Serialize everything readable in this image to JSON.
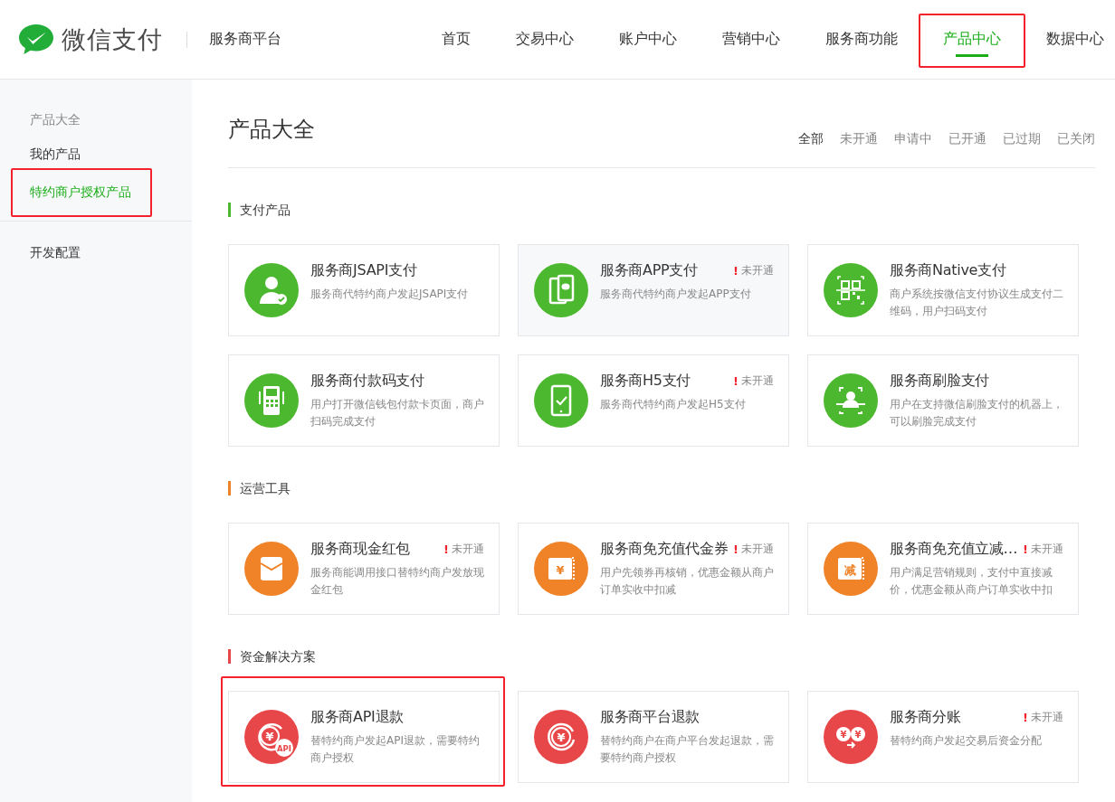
{
  "header": {
    "brand": "微信支付",
    "platform": "服务商平台",
    "nav": [
      {
        "label": "首页",
        "selected": false,
        "highlighted": false
      },
      {
        "label": "交易中心",
        "selected": false,
        "highlighted": false
      },
      {
        "label": "账户中心",
        "selected": false,
        "highlighted": false
      },
      {
        "label": "营销中心",
        "selected": false,
        "highlighted": false
      },
      {
        "label": "服务商功能",
        "selected": false,
        "highlighted": false
      },
      {
        "label": "产品中心",
        "selected": true,
        "highlighted": true
      },
      {
        "label": "数据中心",
        "selected": false,
        "highlighted": false
      }
    ]
  },
  "sidebar": {
    "groups": [
      {
        "heading": "产品大全",
        "items": [
          {
            "label": "我的产品",
            "selected": false,
            "highlighted": false
          },
          {
            "label": "特约商户授权产品",
            "selected": true,
            "highlighted": true
          }
        ]
      },
      {
        "items": [
          {
            "label": "开发配置",
            "selected": false,
            "highlighted": false
          }
        ]
      }
    ]
  },
  "page": {
    "title": "产品大全",
    "filters": [
      {
        "label": "全部",
        "selected": true
      },
      {
        "label": "未开通",
        "selected": false
      },
      {
        "label": "申请中",
        "selected": false
      },
      {
        "label": "已开通",
        "selected": false
      },
      {
        "label": "已过期",
        "selected": false
      },
      {
        "label": "已关闭",
        "selected": false
      }
    ],
    "sections": [
      {
        "title": "支付产品",
        "color": "#4cb82f",
        "products": [
          {
            "kind": "person",
            "name": "服务商JSAPI支付",
            "description": "服务商代特约商户发起JSAPI支付",
            "hovered": false,
            "highlighted": false
          },
          {
            "kind": "phones",
            "name": "服务商APP支付",
            "description": "服务商代特约商户发起APP支付",
            "badge": {
              "mark": "!",
              "text": "未开通"
            },
            "hovered": true,
            "highlighted": false
          },
          {
            "kind": "qr",
            "name": "服务商Native支付",
            "description": "商户系统按微信支付协议生成支付二维码，用户扫码支付",
            "hovered": false,
            "highlighted": false
          },
          {
            "kind": "pos",
            "name": "服务商付款码支付",
            "description": "用户打开微信钱包付款卡页面，商户扫码完成支付",
            "hovered": false,
            "highlighted": false
          },
          {
            "kind": "phone",
            "name": "服务商H5支付",
            "description": "服务商代特约商户发起H5支付",
            "badge": {
              "mark": "!",
              "text": "未开通"
            },
            "hovered": false,
            "highlighted": false
          },
          {
            "kind": "face",
            "name": "服务商刷脸支付",
            "description": "用户在支持微信刷脸支付的机器上，可以刷脸完成支付",
            "hovered": false,
            "highlighted": false
          }
        ]
      },
      {
        "title": "运营工具",
        "color": "#f08228",
        "products": [
          {
            "kind": "envelope",
            "name": "服务商现金红包",
            "description": "服务商能调用接口替特约商户发放现金红包",
            "badge": {
              "mark": "!",
              "text": "未开通"
            },
            "hovered": false,
            "highlighted": false
          },
          {
            "kind": "ticket",
            "icon_text": [
              "¥"
            ],
            "name": "服务商免充值代金券",
            "description": "用户先领券再核销，优惠金额从商户订单实收中扣减",
            "badge": {
              "mark": "!",
              "text": "未开通"
            },
            "hovered": false,
            "highlighted": false
          },
          {
            "kind": "ticket",
            "icon_text": [
              "减"
            ],
            "name": "服务商免充值立减…",
            "description": "用户满足营销规则，支付中直接减价，优惠金额从商户订单实收中扣",
            "badge": {
              "mark": "!",
              "text": "未开通"
            },
            "hovered": false,
            "highlighted": false
          }
        ]
      },
      {
        "title": "资金解决方案",
        "color": "#e8474a",
        "products": [
          {
            "kind": "refund-api",
            "icon_text": [
              "¥",
              "API"
            ],
            "name": "服务商API退款",
            "description": "替特约商户发起API退款，需要特约商户授权",
            "hovered": false,
            "highlighted": true
          },
          {
            "kind": "refund",
            "icon_text": [
              "¥"
            ],
            "name": "服务商平台退款",
            "description": "替特约商户在商户平台发起退款，需要特约商户授权",
            "hovered": false,
            "highlighted": false
          },
          {
            "kind": "split",
            "icon_text": [
              "¥",
              "¥"
            ],
            "name": "服务商分账",
            "description": "替特约商户发起交易后资金分配",
            "badge": {
              "mark": "!",
              "text": "未开通"
            },
            "hovered": false,
            "highlighted": false
          }
        ]
      }
    ]
  }
}
